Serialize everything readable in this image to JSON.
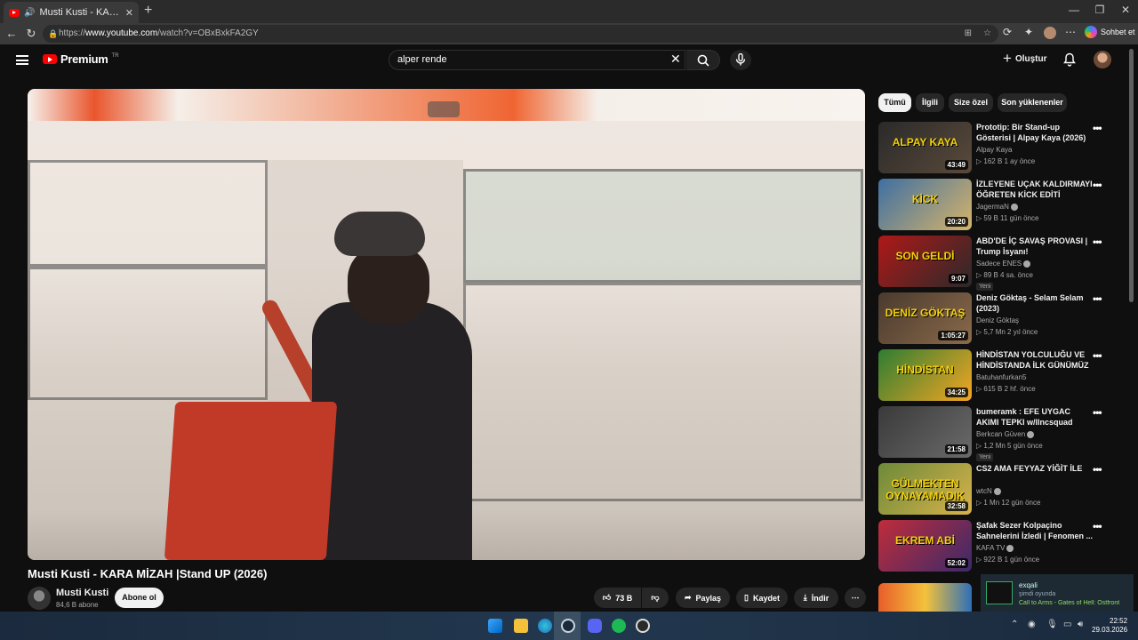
{
  "browser": {
    "tab_title": "Musti Kusti - KARA MİZAH | S",
    "new_tab": "+",
    "url_prefix": "https://",
    "url_domain": "www.youtube.com",
    "url_path": "/watch?v=OBxBxkFA2GY",
    "chat_label": "Sohbet et"
  },
  "header": {
    "logo_text": "Premium",
    "logo_region": "TR",
    "search_value": "alper rende",
    "create_label": "Oluştur"
  },
  "video": {
    "title": "Musti Kusti - KARA MİZAH  |Stand UP (2026)",
    "channel": "Musti Kusti",
    "subscribers": "84,6 B abone",
    "subscribe_label": "Abone ol",
    "likes": "73 B",
    "share_label": "Paylaş",
    "save_label": "Kaydet",
    "download_label": "İndir"
  },
  "chips": [
    "Tümü",
    "İlgili",
    "Size özel",
    "Son yüklenenler"
  ],
  "recommendations": [
    {
      "title": "Prototip: Bir Stand-up Gösterisi | Alpay Kaya (2026)",
      "channel": "Alpay Kaya",
      "meta": "▷ 162 B   1 ay önce",
      "duration": "43:49",
      "thumb_text": "ALPAY KAYA",
      "verified": false,
      "badge": ""
    },
    {
      "title": "İZLEYENE UÇAK KALDIRMAYI ÖĞRETEN KİCK EDİTİ",
      "channel": "JagermaN",
      "meta": "▷ 59 B   11 gün önce",
      "duration": "20:20",
      "thumb_text": "KİCK",
      "verified": true,
      "badge": ""
    },
    {
      "title": "ABD'DE İÇ SAVAŞ PROVASI | Trump İsyanı!",
      "channel": "Sadece ENES",
      "meta": "▷ 89 B   4 sa. önce",
      "duration": "9:07",
      "thumb_text": "SON GELDİ",
      "verified": true,
      "badge": "Yeni"
    },
    {
      "title": "Deniz Göktaş - Selam Selam (2023)",
      "channel": "Deniz Göktaş",
      "meta": "▷ 5,7 Mn   2 yıl önce",
      "duration": "1:05:27",
      "thumb_text": "DENİZ GÖKTAŞ",
      "verified": false,
      "badge": ""
    },
    {
      "title": "HİNDİSTAN YOLCULUĞU VE HİNDİSTANDA İLK GÜNÜMÜZ",
      "channel": "Batuhanfurkan5",
      "meta": "▷ 615 B   2 hf. önce",
      "duration": "34:25",
      "thumb_text": "HİNDİSTAN",
      "verified": false,
      "badge": ""
    },
    {
      "title": "bumeramk : EFE UYGAC AKIMI TEPKI w/llncsquad",
      "channel": "Berkcan Güven",
      "meta": "▷ 1,2 Mn   5 gün önce",
      "duration": "21:58",
      "thumb_text": "",
      "verified": true,
      "badge": "Yeni"
    },
    {
      "title": "CS2 AMA FEYYAZ YİĞİT İLE",
      "channel": "wtcN",
      "meta": "▷ 1 Mn   12 gün önce",
      "duration": "32:58",
      "thumb_text": "GÜLMEKTEN OYNAYAMADIK",
      "verified": true,
      "badge": ""
    },
    {
      "title": "Şafak Sezer Kolpaçino Sahnelerini İzledi | Fenomen ...",
      "channel": "KAFA TV",
      "meta": "▷ 922 B   1 gün önce",
      "duration": "52:02",
      "thumb_text": "EKREM ABİ",
      "verified": true,
      "badge": ""
    }
  ],
  "steam": {
    "name": "exqali",
    "status": "şimdi oyunda",
    "game": "Call to Arms - Gates of Hell: Ostfront"
  },
  "taskbar": {
    "time": "22:52",
    "date": "29.03.2026"
  }
}
